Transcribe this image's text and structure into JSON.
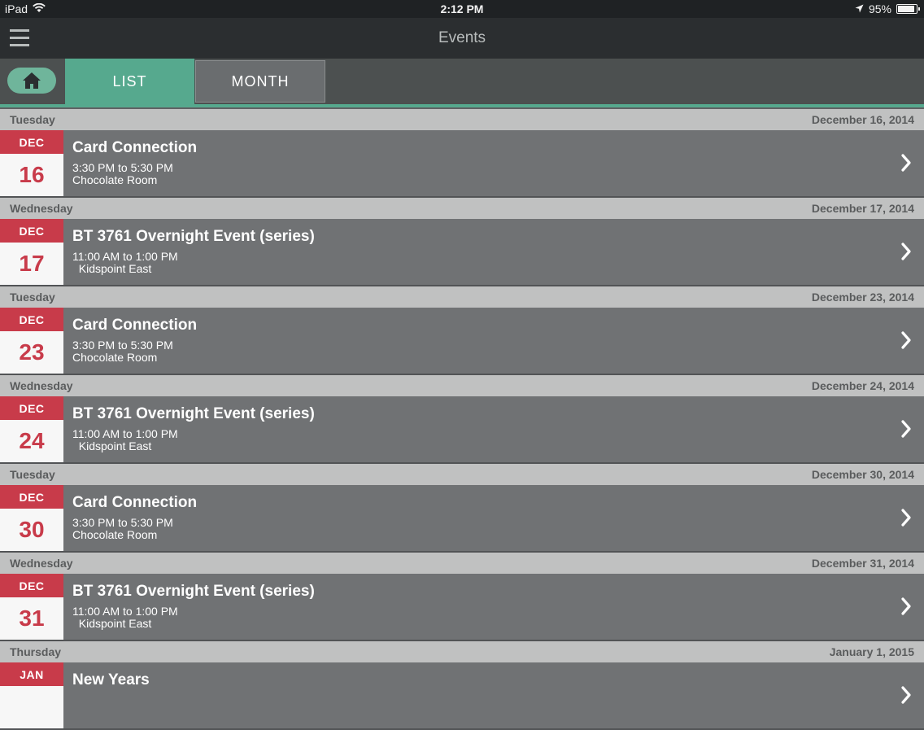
{
  "status_bar": {
    "device": "iPad",
    "time": "2:12 PM",
    "battery": "95%"
  },
  "nav": {
    "title": "Events"
  },
  "tabs": {
    "list_label": "LIST",
    "month_label": "MONTH",
    "active": "LIST"
  },
  "colors": {
    "accent": "#56a98e",
    "date_red": "#c83b4a",
    "row_bg": "#707274",
    "header_bg": "#c0c1c1"
  },
  "days": [
    {
      "weekday": "Tuesday",
      "date": "December 16, 2014",
      "event": {
        "month": "DEC",
        "day": "16",
        "title": "Card Connection",
        "time": "3:30 PM to 5:30 PM",
        "location": "Chocolate Room"
      }
    },
    {
      "weekday": "Wednesday",
      "date": "December 17, 2014",
      "event": {
        "month": "DEC",
        "day": "17",
        "title": "BT 3761 Overnight Event (series)",
        "time": "11:00 AM to 1:00 PM",
        "location": "  Kidspoint East"
      }
    },
    {
      "weekday": "Tuesday",
      "date": "December 23, 2014",
      "event": {
        "month": "DEC",
        "day": "23",
        "title": "Card Connection",
        "time": "3:30 PM to 5:30 PM",
        "location": "Chocolate Room"
      }
    },
    {
      "weekday": "Wednesday",
      "date": "December 24, 2014",
      "event": {
        "month": "DEC",
        "day": "24",
        "title": "BT 3761 Overnight Event (series)",
        "time": "11:00 AM to 1:00 PM",
        "location": "  Kidspoint East"
      }
    },
    {
      "weekday": "Tuesday",
      "date": "December 30, 2014",
      "event": {
        "month": "DEC",
        "day": "30",
        "title": "Card Connection",
        "time": "3:30 PM to 5:30 PM",
        "location": "Chocolate Room"
      }
    },
    {
      "weekday": "Wednesday",
      "date": "December 31, 2014",
      "event": {
        "month": "DEC",
        "day": "31",
        "title": "BT 3761 Overnight Event (series)",
        "time": "11:00 AM to 1:00 PM",
        "location": "  Kidspoint East"
      }
    },
    {
      "weekday": "Thursday",
      "date": "January 1, 2015",
      "event": {
        "month": "JAN",
        "day": "",
        "title": "New Years",
        "time": "",
        "location": ""
      }
    }
  ]
}
